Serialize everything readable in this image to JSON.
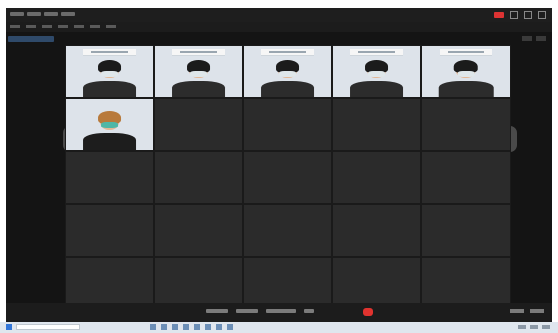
{
  "window": {
    "title": ""
  },
  "meeting": {
    "layout": "gallery",
    "video_tiles": [
      {
        "name": ""
      },
      {
        "name": ""
      },
      {
        "name": ""
      },
      {
        "name": ""
      },
      {
        "name": ""
      },
      {
        "name": ""
      }
    ],
    "participants": [
      "",
      "",
      "",
      "",
      "",
      "",
      "",
      "",
      "",
      "",
      "",
      "",
      "",
      "",
      "",
      "",
      "",
      "",
      ""
    ]
  },
  "colors": {
    "background": "#141414",
    "tile": "#2b2b2b",
    "end_button": "#e0332f",
    "taskbar": "#dfe6ee"
  }
}
